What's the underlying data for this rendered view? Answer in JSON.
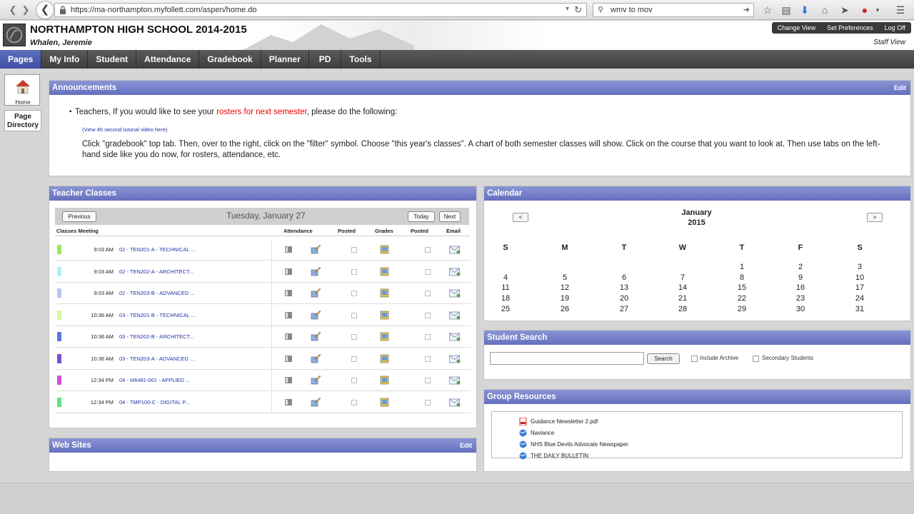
{
  "browser": {
    "url": "https://ma-northampton.myfollett.com/aspen/home.do",
    "search_text": "wmv to mov"
  },
  "header": {
    "school": "NORTHAMPTON HIGH SCHOOL 2014-2015",
    "user": "Whalen, Jeremie",
    "actions": [
      "Change View",
      "Set Preferences",
      "Log Off"
    ],
    "view_label": "Staff View"
  },
  "nav": {
    "tabs": [
      "Pages",
      "My Info",
      "Student",
      "Attendance",
      "Gradebook",
      "Planner",
      "PD",
      "Tools"
    ],
    "active": "Pages"
  },
  "sidebar": {
    "home_label": "Home",
    "page_directory": "Page Directory"
  },
  "announcements": {
    "title": "Announcements",
    "edit": "Edit",
    "line_pre": "Teachers,  If you would like to see your ",
    "line_red": "rosters for next semester",
    "line_post": ", please do the following:",
    "video_link": "(View 45 second tutorial video here)",
    "body": "Click \"gradebook\" top tab.  Then, over to the right, click on the \"filter\" symbol.  Choose \"this year's classes\".  A chart of both semester classes will show.  Click on the course that you want to look at. Then use tabs on the left-hand side like you do now, for rosters, attendance, etc."
  },
  "teacher_classes": {
    "title": "Teacher Classes",
    "previous": "Previous",
    "date": "Tuesday, January 27",
    "today": "Today",
    "next": "Next",
    "columns": [
      "Classes Meeting",
      "Attendance",
      "Posted",
      "Grades",
      "Posted",
      "Email"
    ],
    "rows": [
      {
        "color": "#9be85a",
        "time": "9:03 AM",
        "course": "02 - TEN201-A - TECHNICAL ..."
      },
      {
        "color": "#aef0f4",
        "time": "9:03 AM",
        "course": "02 - TEN202-A - ARCHITECT..."
      },
      {
        "color": "#b9c6f4",
        "time": "9:03 AM",
        "course": "02 - TEN203-B - ADVANCED ..."
      },
      {
        "color": "#d8f7a0",
        "time": "10:36 AM",
        "course": "03 - TEN201-B - TECHNICAL ..."
      },
      {
        "color": "#5a78e0",
        "time": "10:36 AM",
        "course": "03 - TEN202-B - ARCHITECT..."
      },
      {
        "color": "#7a4fd8",
        "time": "10:36 AM",
        "course": "03 - TEN203-A - ADVANCED ..."
      },
      {
        "color": "#d050e0",
        "time": "12:34 PM",
        "course": "04 - M6481-001 - APPLIED ..."
      },
      {
        "color": "#5fe08a",
        "time": "12:34 PM",
        "course": "04 - TMP100-C - DIGITAL P..."
      }
    ]
  },
  "web_sites": {
    "title": "Web Sites",
    "edit": "Edit"
  },
  "calendar": {
    "title": "Calendar",
    "prev": "<",
    "next": ">",
    "month": "January",
    "year": "2015",
    "weekdays": [
      "S",
      "M",
      "T",
      "W",
      "T",
      "F",
      "S"
    ],
    "weeks": [
      [
        "",
        "",
        "",
        "",
        "1",
        "2",
        "3"
      ],
      [
        "4",
        "5",
        "6",
        "7",
        "8",
        "9",
        "10"
      ],
      [
        "11",
        "12",
        "13",
        "14",
        "15",
        "16",
        "17"
      ],
      [
        "18",
        "19",
        "20",
        "21",
        "22",
        "23",
        "24"
      ],
      [
        "25",
        "26",
        "27",
        "28",
        "29",
        "30",
        "31"
      ]
    ]
  },
  "student_search": {
    "title": "Student Search",
    "button": "Search",
    "include_archive": "Include Archive",
    "secondary": "Secondary Students"
  },
  "group_resources": {
    "title": "Group Resources",
    "items": [
      {
        "label": "Guidance Newsletter 2.pdf",
        "icon": "pdf-icon"
      },
      {
        "label": "Naviance",
        "icon": "globe-icon"
      },
      {
        "label": "NHS Blue Devils Advocate Newspaper",
        "icon": "globe-icon"
      },
      {
        "label": "THE DAILY BULLETIN",
        "icon": "globe-icon"
      }
    ]
  }
}
